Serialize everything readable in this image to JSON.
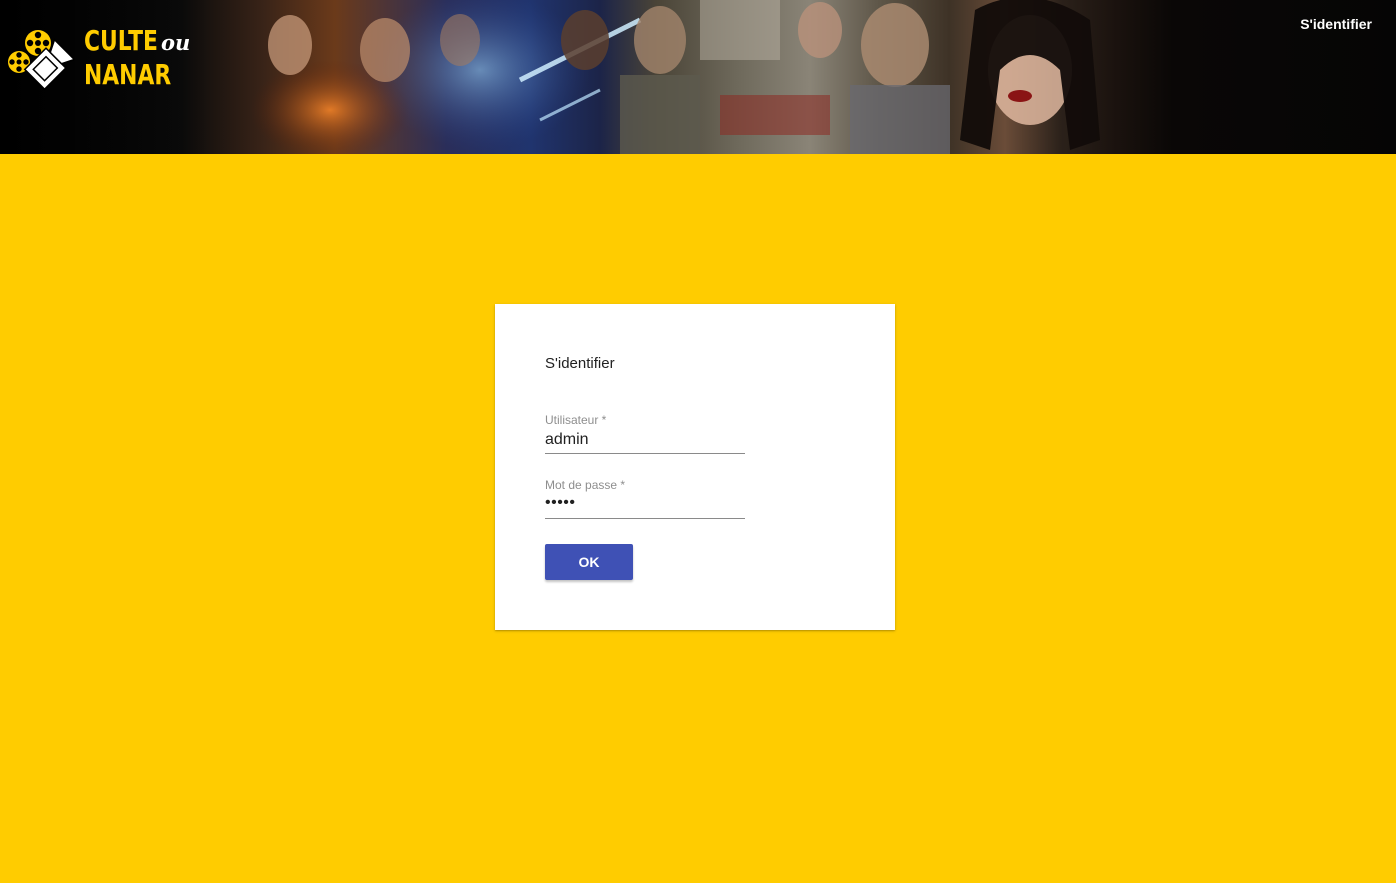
{
  "header": {
    "brand_line1": "CULTE",
    "brand_ou": "ou",
    "brand_line2": "NANAR",
    "login_link": "S'identifier"
  },
  "login_form": {
    "title": "S'identifier",
    "username_label": "Utilisateur *",
    "username_value": "admin",
    "password_label": "Mot de passe *",
    "password_value": "•••••",
    "submit_label": "OK"
  },
  "colors": {
    "background": "#ffcc00",
    "accent": "#3f51b5",
    "brand": "#ffcc00"
  },
  "icons": {
    "logo": "film-reel-camera-icon"
  }
}
